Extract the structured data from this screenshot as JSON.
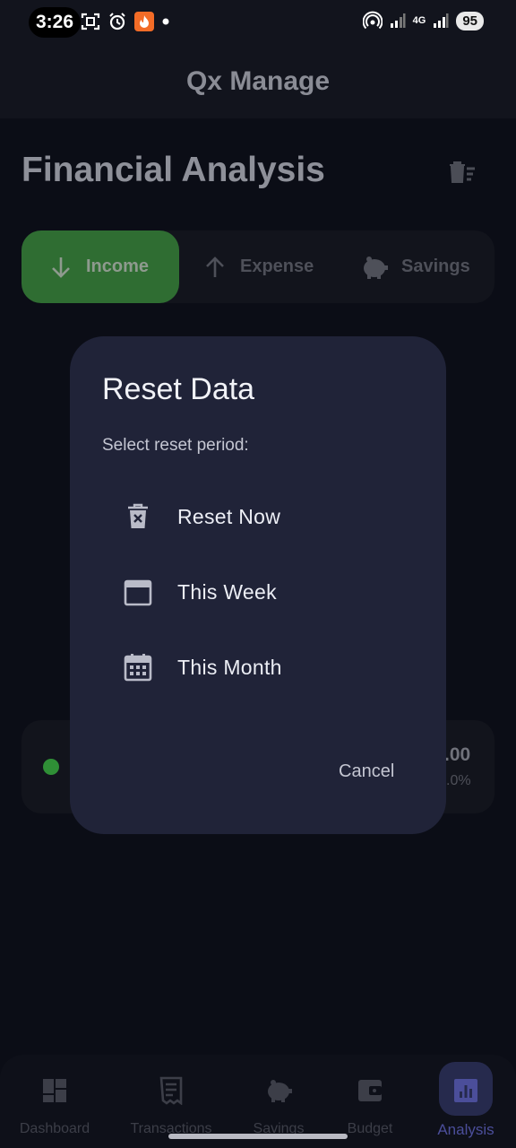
{
  "status_bar": {
    "time": "3:26",
    "battery": "95",
    "network": "4G"
  },
  "app_bar": {
    "title": "Qx Manage"
  },
  "page": {
    "title": "Financial Analysis"
  },
  "tabs": [
    {
      "label": "Income",
      "icon": "arrow-down-icon",
      "selected": true
    },
    {
      "label": "Expense",
      "icon": "arrow-up-icon",
      "selected": false
    },
    {
      "label": "Savings",
      "icon": "piggy-bank-icon",
      "selected": false
    }
  ],
  "background_card": {
    "amount_partial": ".00",
    "percent_partial": ".0%",
    "dot_color": "#2f8f36"
  },
  "dialog": {
    "title": "Reset Data",
    "subtitle": "Select reset period:",
    "options": [
      {
        "label": "Reset Now",
        "icon": "delete-forever-icon"
      },
      {
        "label": "This Week",
        "icon": "calendar-icon"
      },
      {
        "label": "This Month",
        "icon": "calendar-month-icon"
      }
    ],
    "cancel_label": "Cancel"
  },
  "bottom_nav": [
    {
      "label": "Dashboard",
      "icon": "dashboard-icon",
      "active": false
    },
    {
      "label": "Transactions",
      "icon": "receipt-icon",
      "active": false
    },
    {
      "label": "Savings",
      "icon": "piggy-bank-icon",
      "active": false
    },
    {
      "label": "Budget",
      "icon": "wallet-icon",
      "active": false
    },
    {
      "label": "Analysis",
      "icon": "analytics-icon",
      "active": true
    }
  ],
  "colors": {
    "accent_green": "#2f6d32",
    "dialog_bg": "#202338",
    "nav_active": "#4b4e9a"
  }
}
